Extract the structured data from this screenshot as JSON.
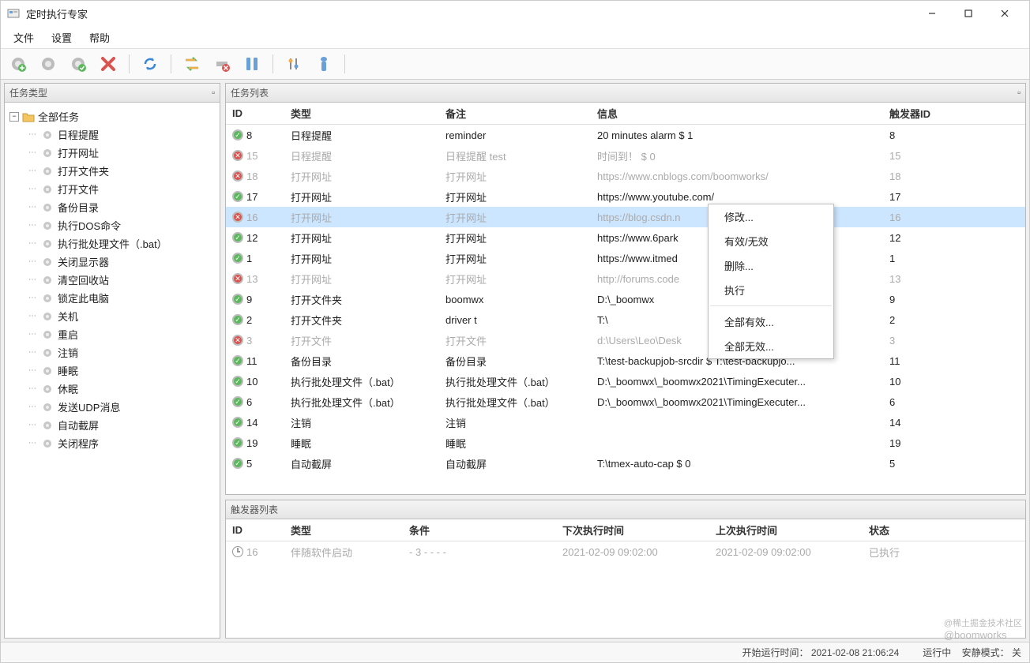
{
  "window": {
    "title": "定时执行专家"
  },
  "menu": {
    "file": "文件",
    "settings": "设置",
    "help": "帮助"
  },
  "panels": {
    "task_types": "任务类型",
    "task_list": "任务列表",
    "trigger_list": "触发器列表"
  },
  "tree": {
    "root": "全部任务",
    "items": [
      "日程提醒",
      "打开网址",
      "打开文件夹",
      "打开文件",
      "备份目录",
      "执行DOS命令",
      "执行批处理文件（.bat）",
      "关闭显示器",
      "清空回收站",
      "锁定此电脑",
      "关机",
      "重启",
      "注销",
      "睡眠",
      "休眠",
      "发送UDP消息",
      "自动截屏",
      "关闭程序"
    ]
  },
  "task_header": {
    "id": "ID",
    "type": "类型",
    "note": "备注",
    "info": "信息",
    "tid": "触发器ID"
  },
  "tasks": [
    {
      "ok": true,
      "id": "8",
      "type": "日程提醒",
      "note": "reminder",
      "info": "20 minutes alarm $ 1",
      "tid": "8"
    },
    {
      "ok": false,
      "id": "15",
      "type": "日程提醒",
      "note": "日程提醒 test",
      "info": "时间到！ $ 0",
      "tid": "15"
    },
    {
      "ok": false,
      "id": "18",
      "type": "打开网址",
      "note": "打开网址",
      "info": "https://www.cnblogs.com/boomworks/",
      "tid": "18"
    },
    {
      "ok": true,
      "id": "17",
      "type": "打开网址",
      "note": "打开网址",
      "info": "https://www.youtube.com/",
      "tid": "17"
    },
    {
      "ok": false,
      "id": "16",
      "type": "打开网址",
      "note": "打开网址",
      "info": "https://blog.csdn.n",
      "tid": "16",
      "selected": true
    },
    {
      "ok": true,
      "id": "12",
      "type": "打开网址",
      "note": "打开网址",
      "info": "https://www.6park",
      "tid": "12"
    },
    {
      "ok": true,
      "id": "1",
      "type": "打开网址",
      "note": "打开网址",
      "info": "https://www.itmed",
      "tid": "1"
    },
    {
      "ok": false,
      "id": "13",
      "type": "打开网址",
      "note": "打开网址",
      "info": "http://forums.code",
      "tid": "13"
    },
    {
      "ok": true,
      "id": "9",
      "type": "打开文件夹",
      "note": "boomwx",
      "info": "D:\\_boomwx",
      "tid": "9"
    },
    {
      "ok": true,
      "id": "2",
      "type": "打开文件夹",
      "note": "driver t",
      "info": "T:\\",
      "tid": "2"
    },
    {
      "ok": false,
      "id": "3",
      "type": "打开文件",
      "note": "打开文件",
      "info": "d:\\Users\\Leo\\Desk",
      "tid": "3"
    },
    {
      "ok": true,
      "id": "11",
      "type": "备份目录",
      "note": "备份目录",
      "info": "T:\\test-backupjob-srcdir $ T:\\test-backupjo...",
      "tid": "11"
    },
    {
      "ok": true,
      "id": "10",
      "type": "执行批处理文件（.bat）",
      "note": "执行批处理文件（.bat）",
      "info": "D:\\_boomwx\\_boomwx2021\\TimingExecuter...",
      "tid": "10"
    },
    {
      "ok": true,
      "id": "6",
      "type": "执行批处理文件（.bat）",
      "note": "执行批处理文件（.bat）",
      "info": "D:\\_boomwx\\_boomwx2021\\TimingExecuter...",
      "tid": "6"
    },
    {
      "ok": true,
      "id": "14",
      "type": "注销",
      "note": "注销",
      "info": "",
      "tid": "14"
    },
    {
      "ok": true,
      "id": "19",
      "type": "睡眠",
      "note": "睡眠",
      "info": "",
      "tid": "19"
    },
    {
      "ok": true,
      "id": "5",
      "type": "自动截屏",
      "note": "自动截屏",
      "info": "T:\\tmex-auto-cap $ 0",
      "tid": "5"
    }
  ],
  "context_menu": {
    "modify": "修改...",
    "toggle": "有效/无效",
    "delete": "删除...",
    "execute": "执行",
    "all_enable": "全部有效...",
    "all_disable": "全部无效..."
  },
  "trigger_header": {
    "id": "ID",
    "type": "类型",
    "cond": "条件",
    "next": "下次执行时间",
    "last": "上次执行时间",
    "state": "状态"
  },
  "triggers": [
    {
      "id": "16",
      "type": "伴随软件启动",
      "cond": "- 3 - - - -",
      "next": "2021-02-09 09:02:00",
      "last": "2021-02-09 09:02:00",
      "state": "已执行"
    }
  ],
  "statusbar": {
    "start_time": "开始运行时间：  2021-02-08 21:06:24",
    "running": "运行中",
    "hint_label": "安静模式：",
    "hint_value": "关"
  },
  "watermark": {
    "line1": "@稀土掘金技术社区",
    "line2": "@boomworks"
  }
}
